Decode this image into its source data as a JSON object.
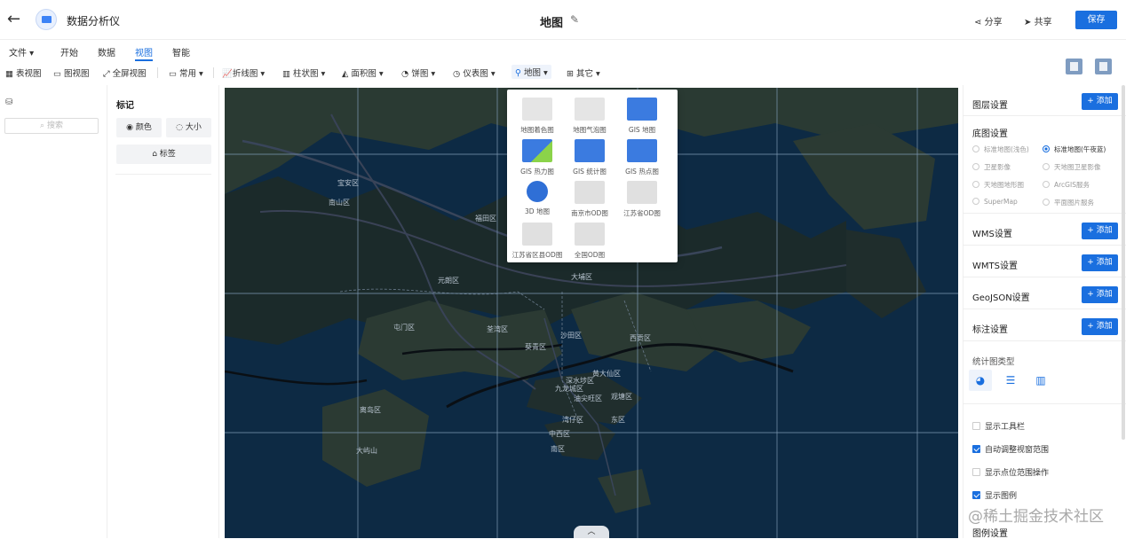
{
  "header": {
    "back_icon": "arrow-left-icon",
    "app_name": "数据分析仪",
    "doc_title": "地图",
    "share_label": "分享",
    "share2_label": "共享",
    "save_label": "保存"
  },
  "menu": [
    "文件",
    "开始",
    "数据",
    "视图",
    "智能"
  ],
  "menu_active": "视图",
  "toolbar": {
    "table_view": "表视图",
    "chart_view": "图视图",
    "fullscreen": "全屏视图",
    "common": "常用",
    "line": "折线图",
    "bar": "柱状图",
    "area": "面积图",
    "pie": "饼图",
    "gauge": "仪表图",
    "map": "地图",
    "other": "其它"
  },
  "left": {
    "search_placeholder": "搜索"
  },
  "marks": {
    "title": "标记",
    "color": "颜色",
    "size": "大小",
    "label": "标签"
  },
  "map_dropdown": [
    "地图着色图",
    "地图气泡图",
    "GIS 地图",
    "GIS 热力图",
    "GIS 统计图",
    "GIS 热点图",
    "3D 地图",
    "南京市OD图",
    "江苏省OD图",
    "江苏省区县OD图",
    "全国OD图"
  ],
  "map_labels": {
    "l1": "宝安区",
    "l2": "南山区",
    "l3": "福田区",
    "l4": "元朗区",
    "l5": "大埔区",
    "l6": "屯门区",
    "l7": "荃湾区",
    "l8": "沙田区",
    "l9": "葵青区",
    "l10": "西贡区",
    "l11": "黄大仙区",
    "l12": "深水埗区",
    "l13": "九龙城区",
    "l14": "油尖旺区",
    "l15": "观塘区",
    "l16": "离岛区",
    "l17": "湾仔区",
    "l18": "东区",
    "l19": "中西区",
    "l20": "南区",
    "l21": "大屿山"
  },
  "right": {
    "layer_settings": "图层设置",
    "add": "添加",
    "base_settings": "底图设置",
    "base_options": [
      "标准地图(浅色)",
      "标准地图(午夜蓝)",
      "卫星影像",
      "天地图卫星影像",
      "天地图地形图",
      "ArcGIS服务",
      "SuperMap",
      "平面图片服务"
    ],
    "base_selected": "标准地图(午夜蓝)",
    "wms": "WMS设置",
    "wmts": "WMTS设置",
    "geojson": "GeoJSON设置",
    "annot": "标注设置",
    "stat_type": "统计图类型",
    "show_toolbar": "显示工具栏",
    "auto_adjust": "自动调整视窗范围",
    "show_point_range": "显示点位范围操作",
    "show_legend": "显示图例",
    "legend_settings": "图例设置"
  },
  "watermark": "@稀土掘金技术社区",
  "colors": {
    "accent": "#1a6fdf",
    "map_water": "#0d2a44",
    "map_land": "#2a3a33"
  }
}
